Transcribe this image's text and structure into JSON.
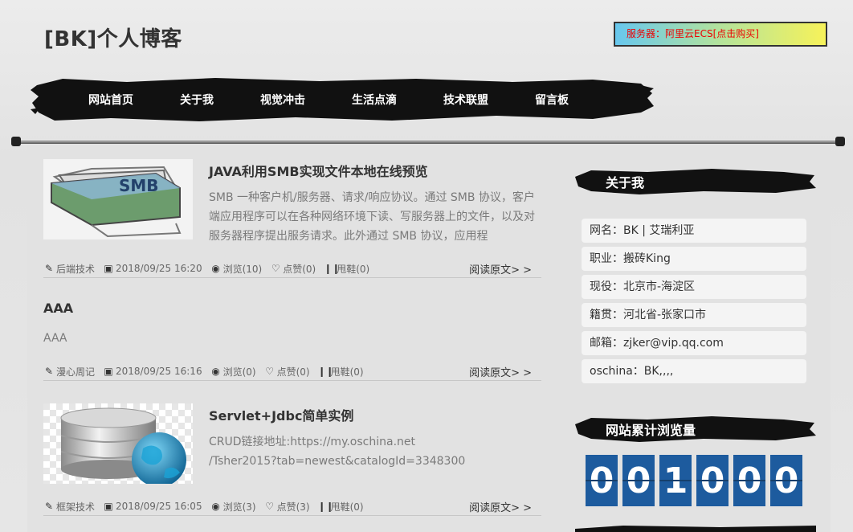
{
  "header": {
    "site_title": "[BK]个人博客",
    "server_label": "服务器：",
    "server_link": "阿里云ECS[点击购买]"
  },
  "nav": {
    "items": [
      "网站首页",
      "关于我",
      "视觉冲击",
      "生活点滴",
      "技术联盟",
      "留言板"
    ]
  },
  "articles": [
    {
      "title": "JAVA利用SMB实现文件本地在线预览",
      "summary_lines": [
        "SMB 一种客户机/服务器、请求/响应协议。通过 SMB 协议，客户",
        "端应用程序可以在各种网络环境下读、写服务器上的文件，以及对",
        "服务器程序提出服务请求。此外通过 SMB 协议，应用程"
      ],
      "category": "后端技术",
      "date": "2018/09/25 16:20",
      "views": "浏览(10)",
      "likes": "点赞(0)",
      "dislikes": "甩鞋(0)",
      "read_more": "阅读原文> >",
      "thumb_text": "SMB"
    },
    {
      "title": "AAA",
      "summary_lines": [
        "AAA"
      ],
      "category": "漫心周记",
      "date": "2018/09/25 16:16",
      "views": "浏览(0)",
      "likes": "点赞(0)",
      "dislikes": "甩鞋(0)",
      "read_more": "阅读原文> >"
    },
    {
      "title": "Servlet+Jdbc简单实例",
      "summary_lines": [
        "CRUD链接地址:https://my.oschina.net",
        "/Tsher2015?tab=newest&catalogId=3348300"
      ],
      "category": "框架技术",
      "date": "2018/09/25 16:05",
      "views": "浏览(3)",
      "likes": "点赞(3)",
      "dislikes": "甩鞋(0)",
      "read_more": "阅读原文> >"
    }
  ],
  "sidebar": {
    "about_title": "关于我",
    "about_rows": [
      "网名：BK | 艾瑞利亚",
      "职业：搬砖King",
      "现役：北京市-海淀区",
      "籍贯：河北省-张家口市",
      "邮箱：zjker@vip.qq.com",
      "oschina：BK,,,,"
    ],
    "counter_title": "网站累计浏览量",
    "counter_digits": [
      "0",
      "0",
      "1",
      "0",
      "0",
      "0"
    ]
  },
  "colors": {
    "server_text": "#e00000",
    "counter_digit_bg": "#1d5b9e",
    "nav_brush": "#111111"
  },
  "icons": {
    "category": "pencil-icon",
    "date": "calendar-icon",
    "views": "eye-icon",
    "likes": "heart-icon",
    "dislikes": "shoe-icon"
  }
}
